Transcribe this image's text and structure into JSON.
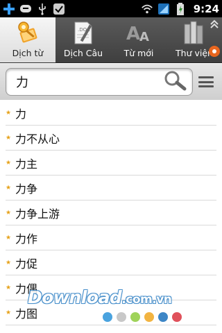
{
  "status_bar": {
    "time": "9:24",
    "icons": [
      "add-icon",
      "message-icon",
      "usb-icon",
      "check-icon",
      "wifi-icon",
      "signal-icon",
      "battery-icon"
    ]
  },
  "tabs": [
    {
      "label": "Dịch từ",
      "icon": "dictionary-key-icon",
      "active": true
    },
    {
      "label": "Dịch Câu",
      "icon": "document-pencil-icon",
      "active": false
    },
    {
      "label": "Từ mới",
      "icon": "font-aa-icon",
      "active": false
    },
    {
      "label": "Thư viện",
      "icon": "books-icon",
      "active": false
    }
  ],
  "search": {
    "value": "力",
    "placeholder": ""
  },
  "words": [
    "力",
    "力不从心",
    "力主",
    "力争",
    "力争上游",
    "力作",
    "力促",
    "力偶",
    "力图"
  ],
  "watermark": {
    "text": "Download",
    "domain": ".com.vn"
  },
  "colors": {
    "star": "#e6a21a",
    "watermark_blue": "#2d7fc4",
    "dots": [
      "#4aa3df",
      "#c8c8c8",
      "#9fd35a",
      "#f2b441",
      "#3d86c6",
      "#e0515b"
    ]
  }
}
